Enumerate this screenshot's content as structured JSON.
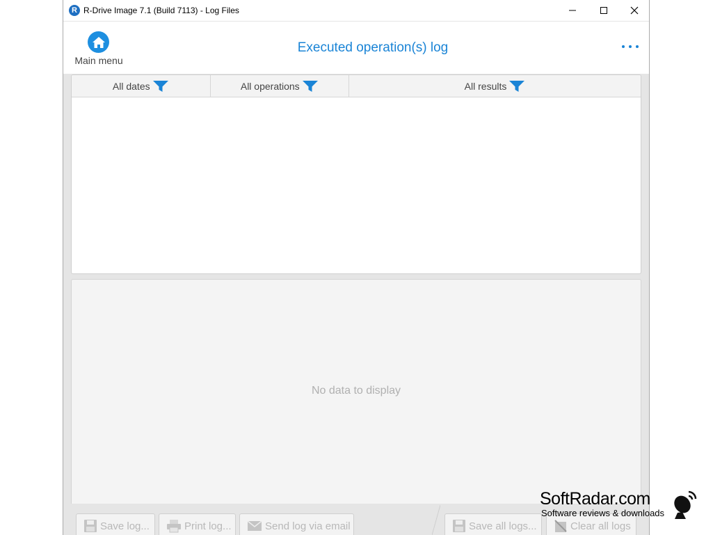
{
  "window": {
    "title": "R-Drive Image 7.1 (Build 7113) - Log Files",
    "app_icon_letter": "R"
  },
  "toolbar": {
    "main_menu_label": "Main menu",
    "page_title": "Executed operation(s) log"
  },
  "table": {
    "columns": [
      {
        "label": "All dates"
      },
      {
        "label": "All operations"
      },
      {
        "label": "All results"
      }
    ]
  },
  "details": {
    "empty_text": "No data to display"
  },
  "bottom_bar": {
    "save_log": "Save log...",
    "print_log": "Print log...",
    "send_log": "Send log via email",
    "save_all_logs": "Save all logs...",
    "clear_all_logs": "Clear all logs"
  },
  "watermark": {
    "brand": "SoftRadar.com",
    "tagline": "Software reviews & downloads"
  },
  "colors": {
    "accent": "#1a84d6",
    "home_button": "#1e8fe0",
    "disabled_text": "#b8b8b8"
  },
  "icons": {
    "home": "home-icon",
    "filter": "filter-icon",
    "more": "more-icon",
    "save": "floppy-icon",
    "print": "printer-icon",
    "email": "envelope-icon",
    "clear": "clear-icon"
  }
}
